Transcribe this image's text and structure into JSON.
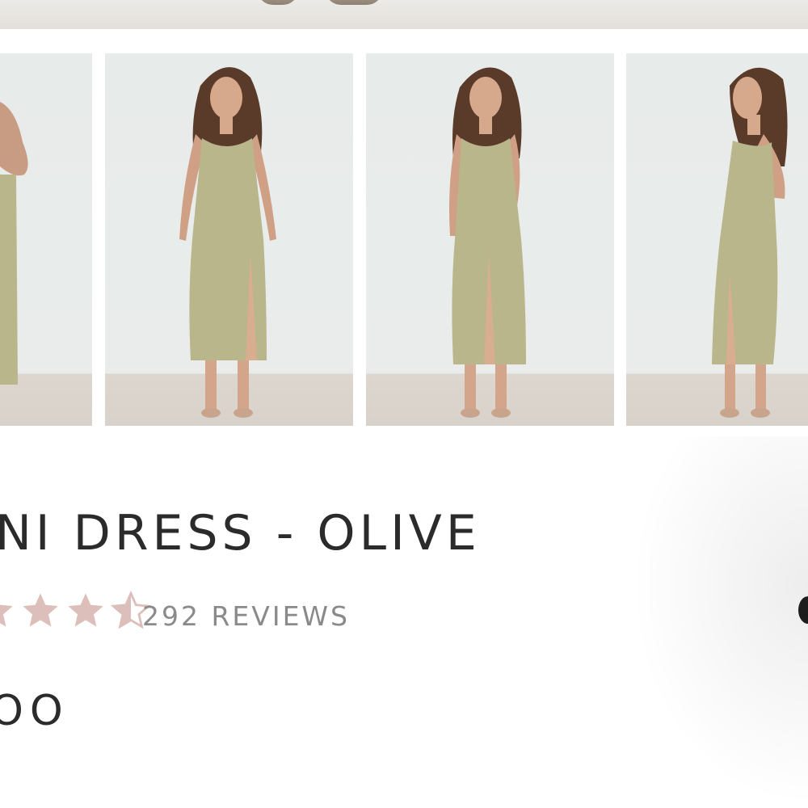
{
  "product": {
    "title": "NI DRESS - OLIVE",
    "price": "OO",
    "rating": {
      "value": 3.5,
      "max": 5,
      "reviews_label": "292 REVIEWS"
    }
  },
  "gallery": {
    "thumbnails": [
      {
        "view": "cropped"
      },
      {
        "view": "front"
      },
      {
        "view": "front"
      },
      {
        "view": "side"
      }
    ]
  },
  "colors": {
    "star": "#dcbfba",
    "dress": "#b8b68a",
    "text": "#2b2b2b",
    "muted": "#8a8a8a"
  }
}
